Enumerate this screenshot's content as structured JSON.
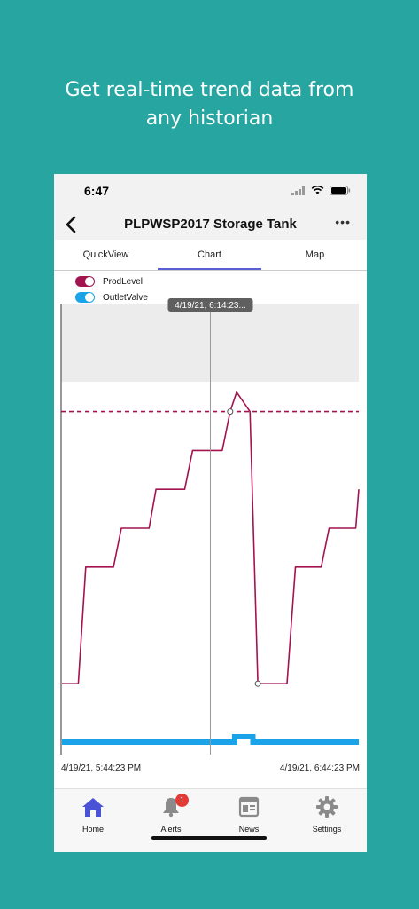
{
  "headline": {
    "line1": "Get real-time trend data from",
    "line2": "any historian"
  },
  "status_bar": {
    "time": "6:47"
  },
  "nav": {
    "title": "PLPWSP2017 Storage Tank",
    "more_label": "•••"
  },
  "tabs": [
    {
      "label": "QuickView",
      "active": false
    },
    {
      "label": "Chart",
      "active": true
    },
    {
      "label": "Map",
      "active": false
    }
  ],
  "legend": [
    {
      "label": "ProdLevel",
      "color": "#a3134f",
      "enabled": true
    },
    {
      "label": "OutletValve",
      "color": "#1aa3e8",
      "enabled": true
    }
  ],
  "cursor": {
    "label": "4/19/21, 6:14:23..."
  },
  "x_axis": {
    "start": "4/19/21, 5:44:23 PM",
    "end": "4/19/21, 6:44:23 PM"
  },
  "chart_data": {
    "type": "line",
    "x_range": [
      "4/19/21, 5:44:23 PM",
      "4/19/21, 6:44:23 PM"
    ],
    "grid": false,
    "legend_position": "top-left",
    "series": [
      {
        "name": "ProdLevel",
        "color": "#a3134f",
        "minutes": [
          0,
          3.3,
          4.8,
          10.4,
          12.0,
          17.6,
          19.0,
          24.8,
          26.4,
          32.4,
          34.0,
          35.3,
          38.0,
          39.6,
          45.5,
          47.2,
          52.4,
          54.0,
          59.4,
          60.0
        ],
        "values": [
          1,
          1,
          4,
          4,
          5,
          5,
          6,
          6,
          7,
          7,
          8,
          8.5,
          8,
          1,
          1,
          4,
          4,
          5,
          5,
          6
        ]
      },
      {
        "name": "OutletValve",
        "color": "#1aa3e8",
        "minutes": [
          0,
          34.9,
          34.9,
          38.6,
          38.6,
          60.0
        ],
        "values": [
          0,
          0,
          1,
          1,
          0,
          0
        ]
      }
    ],
    "threshold": {
      "value": 8
    },
    "cursor_minute": 30,
    "cursor_value": 8,
    "y_range": [
      0,
      10
    ]
  },
  "tab_bar": {
    "items": [
      {
        "label": "Home",
        "icon": "home-icon",
        "active": true
      },
      {
        "label": "Alerts",
        "icon": "bell-icon",
        "badge": "1"
      },
      {
        "label": "News",
        "icon": "news-icon"
      },
      {
        "label": "Settings",
        "icon": "gear-icon"
      }
    ]
  },
  "colors": {
    "background": "#27a5a1",
    "accent": "#5b5fd6",
    "prod": "#a3134f",
    "valve": "#1aa3e8"
  }
}
